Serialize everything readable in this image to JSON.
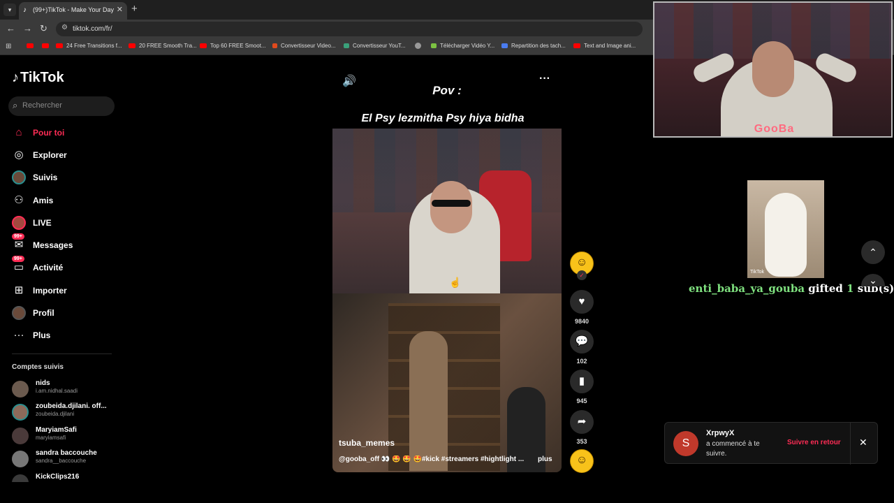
{
  "browser": {
    "tab_title": "(99+)TikTok - Make Your Day",
    "url": "tiktok.com/fr/",
    "bookmarks": [
      {
        "label": "",
        "icon": "youtube-icon"
      },
      {
        "label": "",
        "icon": "youtube-icon"
      },
      {
        "label": "24 Free Transitions f...",
        "icon": "youtube-icon"
      },
      {
        "label": "20 FREE Smooth Tra...",
        "icon": "youtube-icon"
      },
      {
        "label": "Top 60 FREE Smoot...",
        "icon": "youtube-icon"
      },
      {
        "label": "Convertisseur Video...",
        "icon": "z-icon"
      },
      {
        "label": "Convertisseur YouT...",
        "icon": "converter-icon"
      },
      {
        "label": "",
        "icon": "globe-icon"
      },
      {
        "label": "Télécharger Vidéo Y...",
        "icon": "download-icon"
      },
      {
        "label": "Repartition des tach...",
        "icon": "doc-icon"
      },
      {
        "label": "Text and Image ani...",
        "icon": "youtube-icon"
      }
    ]
  },
  "sidebar": {
    "logo": "TikTok",
    "search_placeholder": "Rechercher",
    "nav": [
      {
        "label": "Pour toi",
        "icon": "home-icon",
        "active": true
      },
      {
        "label": "Explorer",
        "icon": "compass-icon"
      },
      {
        "label": "Suivis",
        "icon": "avatar-icon"
      },
      {
        "label": "Amis",
        "icon": "friends-icon"
      },
      {
        "label": "LIVE",
        "icon": "live-icon"
      },
      {
        "label": "Messages",
        "icon": "messages-icon",
        "badge": "99+"
      },
      {
        "label": "Activité",
        "icon": "activity-icon",
        "badge": "99+"
      },
      {
        "label": "Importer",
        "icon": "upload-icon"
      },
      {
        "label": "Profil",
        "icon": "profile-icon"
      },
      {
        "label": "Plus",
        "icon": "more-icon"
      }
    ],
    "following_title": "Comptes suivis",
    "following": [
      {
        "name": "nids",
        "handle": "i.am.nidhal.saadi"
      },
      {
        "name": "zoubeida.djilani. off...",
        "handle": "zoubeida.djilani"
      },
      {
        "name": "MaryiamSafi",
        "handle": "maryiamsafi"
      },
      {
        "name": "sandra baccouche",
        "handle": "sandra__baccouche"
      },
      {
        "name": "KickClips216",
        "handle": ""
      }
    ]
  },
  "video": {
    "caption_line1": "Pov :",
    "caption_line2": "El Psy lezmitha Psy hiya bidha",
    "author": "tsuba_memes",
    "description": "@gooba_off 👀 🤩 🤩 🤩#kick #streamers #hightlight ...",
    "more": "plus",
    "likes": "9840",
    "comments": "102",
    "saves": "945",
    "shares": "353"
  },
  "overlay": {
    "cam_logo": "GooBa",
    "gift_user": "enti_baba_ya_gouba",
    "gift_text": "gifted",
    "gift_count": "1",
    "gift_unit": "sub(s)!",
    "sticker_mark": "TikTok"
  },
  "notification": {
    "avatar_letter": "S",
    "user": "XrpwyX",
    "text": "a commencé à te suivre.",
    "action": "Suivre en retour"
  }
}
